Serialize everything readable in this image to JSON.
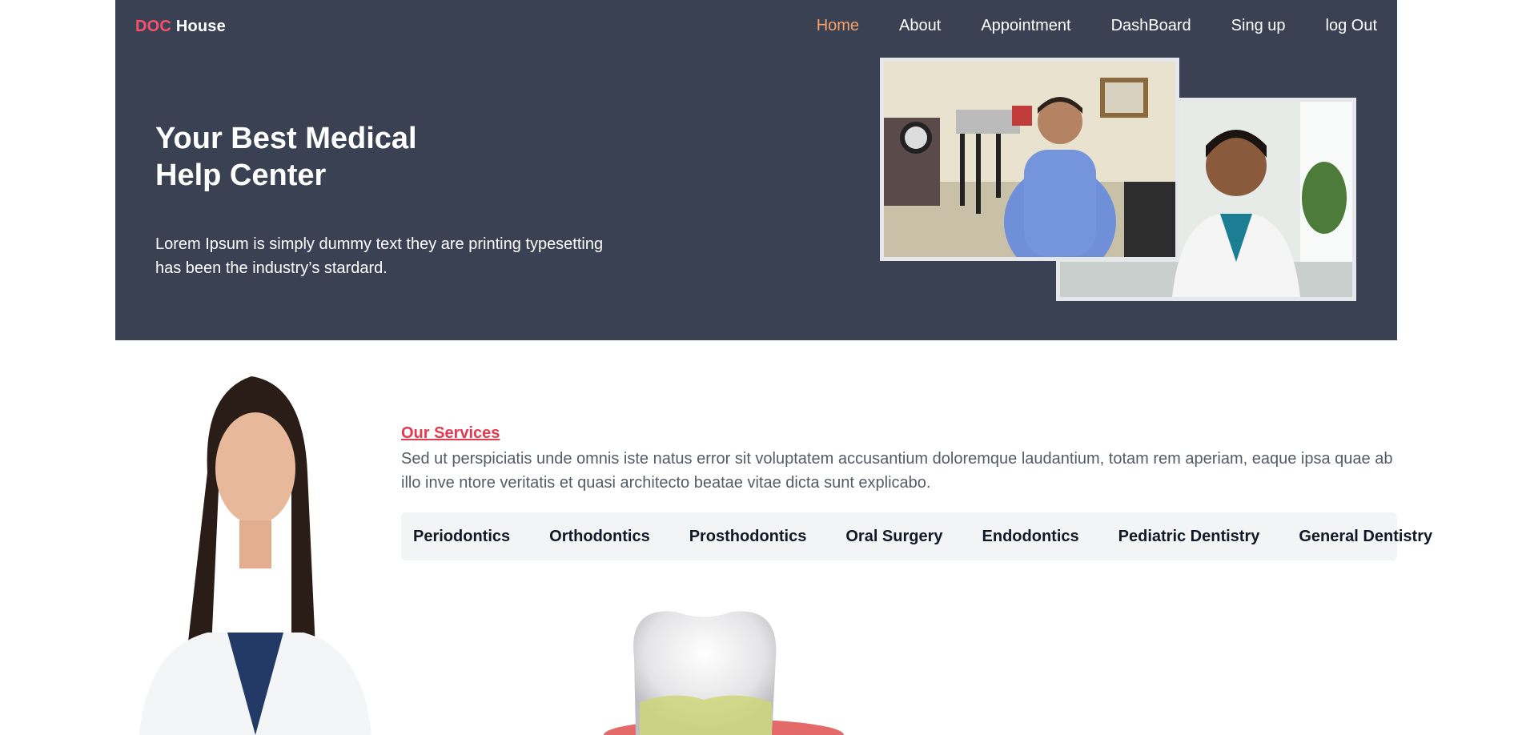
{
  "header": {
    "brand_prefix": "DOC",
    "brand_suffix": "House",
    "nav": [
      {
        "label": "Home"
      },
      {
        "label": "About"
      },
      {
        "label": "Appointment"
      },
      {
        "label": "DashBoard"
      },
      {
        "label": "Sing up"
      },
      {
        "label": "log Out"
      }
    ]
  },
  "hero": {
    "title_line1": "Your Best Medical",
    "title_line2": "Help Center",
    "text_line1": "Lorem Ipsum is simply dummy text they are printing typesetting",
    "text_line2": "has been the industry’s stardard."
  },
  "services": {
    "title": "Our Services",
    "description": "Sed ut perspiciatis unde omnis iste natus error sit voluptatem accusantium doloremque laudantium, totam rem aperiam, eaque ipsa quae ab illo inve ntore veritatis et quasi architecto beatae vitae dicta sunt explicabo.",
    "tabs": [
      {
        "label": "Periodontics"
      },
      {
        "label": "Orthodontics"
      },
      {
        "label": "Prosthodontics"
      },
      {
        "label": "Oral Surgery"
      },
      {
        "label": "Endodontics"
      },
      {
        "label": "Pediatric Dentistry"
      },
      {
        "label": "General Dentistry"
      }
    ]
  },
  "colors": {
    "hero_bg": "#3a4152",
    "brand_accent": "#f7506b",
    "nav_active": "#f7a26a",
    "services_title": "#e5394f"
  }
}
